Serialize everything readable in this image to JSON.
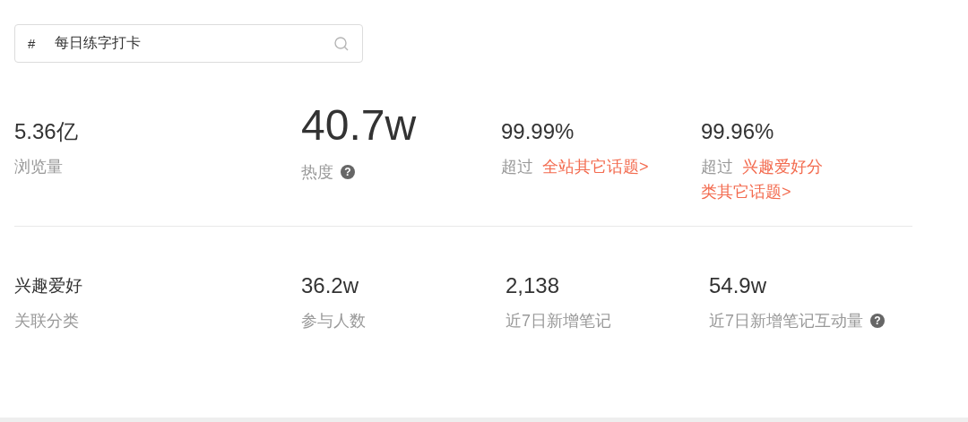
{
  "search": {
    "prefix": "#",
    "value": "每日练字打卡"
  },
  "topic_stats": [
    {
      "value": "5.36亿",
      "label": "浏览量",
      "kind": "metric"
    },
    {
      "value": "40.7w",
      "label": "热度",
      "kind": "headline",
      "help": "?"
    },
    {
      "value": "99.99%",
      "prefix": "超过",
      "link": "全站其它话题>",
      "kind": "metric"
    },
    {
      "value": "99.96%",
      "prefix": "超过",
      "link": "兴趣爱好分类其它话题>",
      "kind": "metric"
    }
  ],
  "category_stats": [
    {
      "value": "兴趣爱好",
      "label": "关联分类",
      "kind": "text"
    },
    {
      "value": "36.2w",
      "label": "参与人数",
      "kind": "number"
    },
    {
      "value": "2,138",
      "label": "近7日新增笔记",
      "kind": "number"
    },
    {
      "value": "54.9w",
      "label": "近7日新增笔记互动量",
      "kind": "number",
      "help": "?"
    }
  ]
}
